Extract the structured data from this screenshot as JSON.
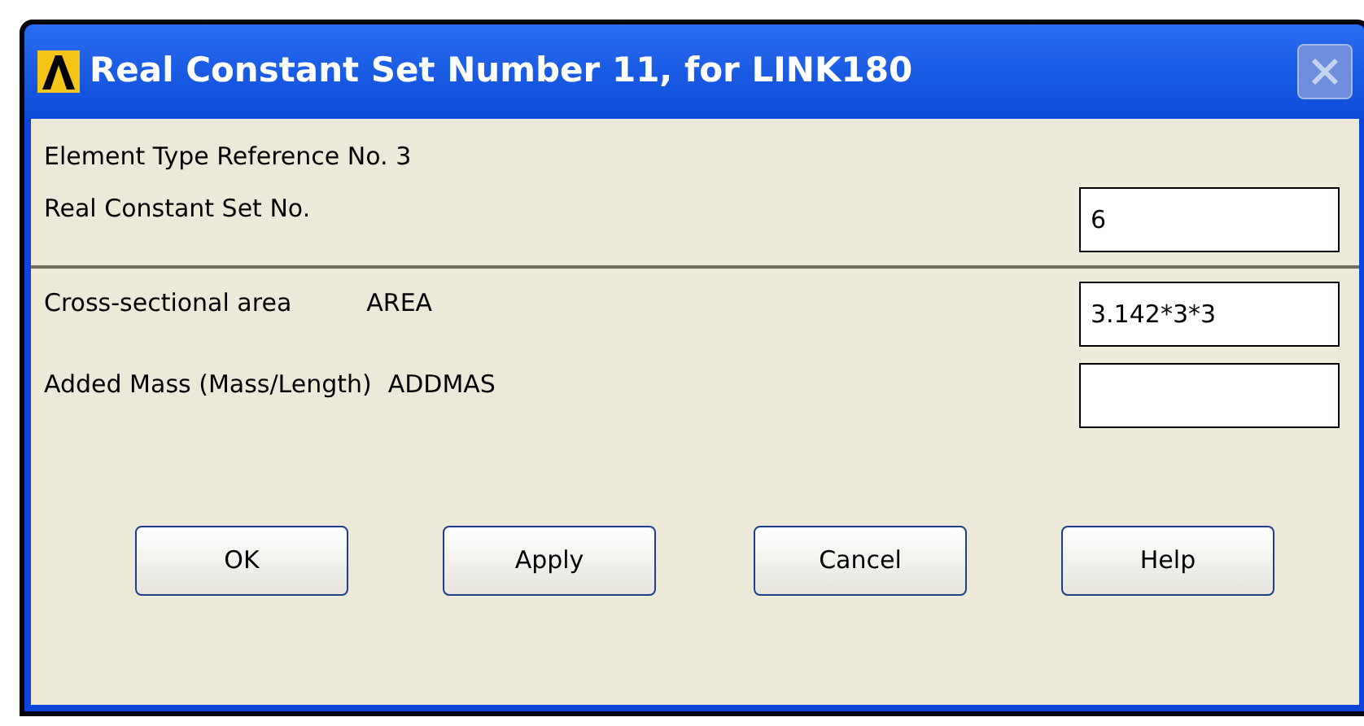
{
  "window": {
    "title": "Real Constant Set Number 11, for LINK180"
  },
  "header_text": "Element Type Reference No. 3",
  "set_field": {
    "label": "Real Constant Set No.",
    "value": "6"
  },
  "fields": [
    {
      "label": "Cross-sectional area",
      "code": "AREA",
      "value": "3.142*3*3"
    },
    {
      "label": "Added Mass (Mass/Length)",
      "code": "ADDMAS"
    }
  ],
  "buttons": [
    "OK",
    "Apply",
    "Cancel",
    "Help"
  ]
}
